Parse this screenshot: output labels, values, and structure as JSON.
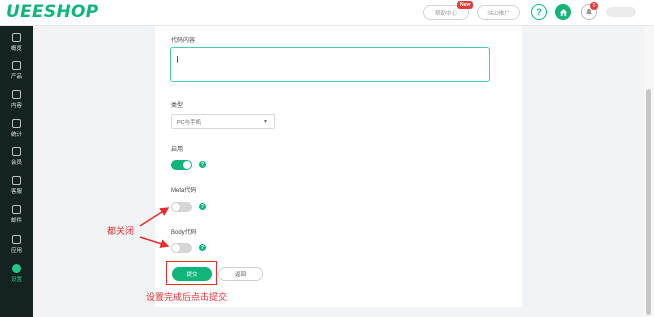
{
  "header": {
    "logo": "UEESHOP",
    "pill1_label": "帮助中心",
    "new_badge": "New",
    "pill2_label": "SEO推广",
    "help_glyph": "?",
    "notification_count": "0"
  },
  "sidebar": {
    "items": [
      {
        "label": "概览",
        "icon": "dashboard-icon"
      },
      {
        "label": "产品",
        "icon": "product-icon"
      },
      {
        "label": "内容",
        "icon": "content-icon"
      },
      {
        "label": "统计",
        "icon": "chart-icon"
      },
      {
        "label": "会员",
        "icon": "user-icon"
      },
      {
        "label": "客服",
        "icon": "service-icon"
      },
      {
        "label": "邮件",
        "icon": "mail-icon"
      },
      {
        "label": "应用",
        "icon": "apps-icon"
      },
      {
        "label": "设置",
        "icon": "settings-icon"
      }
    ],
    "active_index": 8,
    "active_color": "#1ec98a"
  },
  "form": {
    "code_content_label": "代码内容",
    "type_label": "类型",
    "type_value": "PC与手机",
    "enable_label": "启用",
    "meta_label": "Meta代码",
    "body_label": "Body代码",
    "submit_label": "提交",
    "back_label": "返回",
    "enable_on": true,
    "meta_on": false,
    "body_on": false
  },
  "annotations": {
    "all_off": "都关闭",
    "submit_hint": "设置完成后点击提交",
    "color": "#e52d2d"
  },
  "colors": {
    "brand": "#10b57a",
    "sidebar_bg": "#14231f"
  }
}
